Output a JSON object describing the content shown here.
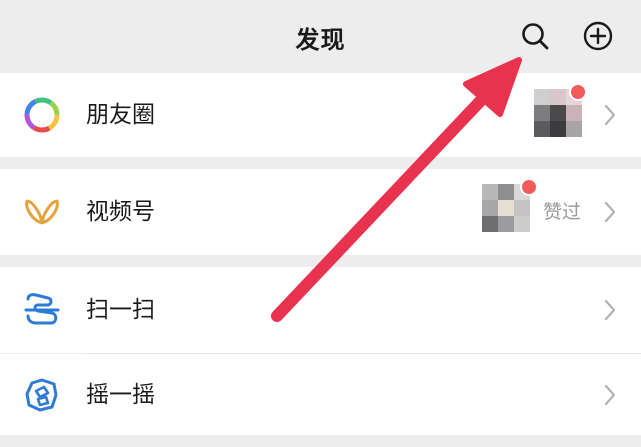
{
  "header": {
    "title": "发现",
    "search_icon": "search-icon",
    "add_icon": "plus-circle-icon"
  },
  "rows": [
    {
      "label": "朋友圈",
      "icon": "moments-aperture-icon",
      "has_thumb": true,
      "has_red_dot": true
    },
    {
      "label": "视频号",
      "icon": "channels-butterfly-icon",
      "has_thumb": true,
      "has_red_dot": true,
      "status": "赞过"
    },
    {
      "label": "扫一扫",
      "icon": "scan-icon"
    },
    {
      "label": "摇一摇",
      "icon": "shake-icon"
    }
  ],
  "annotation": {
    "type": "arrow",
    "color": "#e8334f",
    "points_to": "search-button"
  },
  "colors": {
    "background": "#ededed",
    "row_background": "#ffffff",
    "badge_red": "#f35b5b",
    "channels_gold": "#e3a33d",
    "scan_blue": "#2e7bd6",
    "muted_text": "#9a9a9a"
  }
}
